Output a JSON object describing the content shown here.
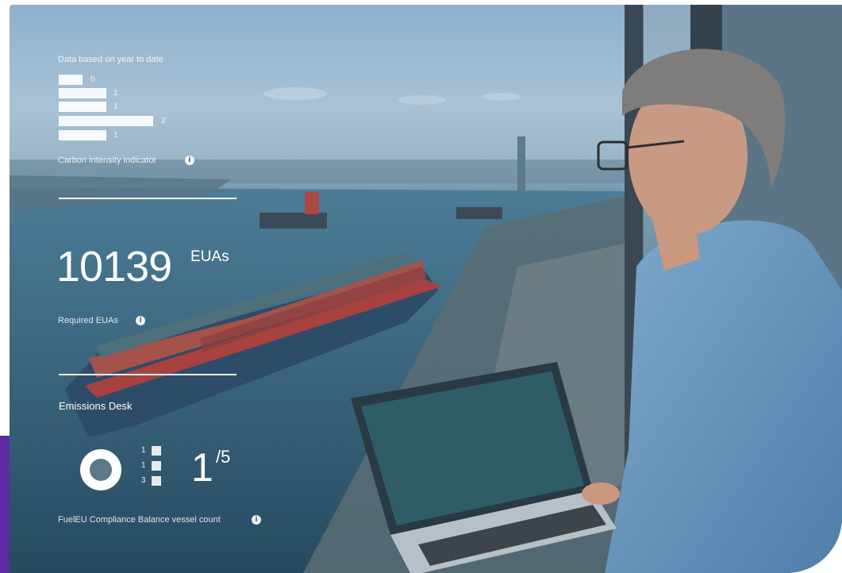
{
  "ytd_caption": "Data based on year to date",
  "cii": {
    "values": [
      0,
      1,
      1,
      2,
      1
    ],
    "label": "Carbon intensity indicator",
    "info_glyph": "i"
  },
  "euas": {
    "value": "10139",
    "unit": "EUAs",
    "label": "Required EUAs",
    "info_glyph": "i"
  },
  "emissions_desk": {
    "title": "Emissions Desk",
    "legend_values": [
      "1",
      "1",
      "3"
    ],
    "ratio_numerator": "1",
    "ratio_denominator": "/5",
    "label": "FuelEU Compliance Balance vessel count",
    "info_glyph": "i"
  },
  "colors": {
    "accent": "#5a2ca0",
    "overlay_text": "#ffffff"
  }
}
